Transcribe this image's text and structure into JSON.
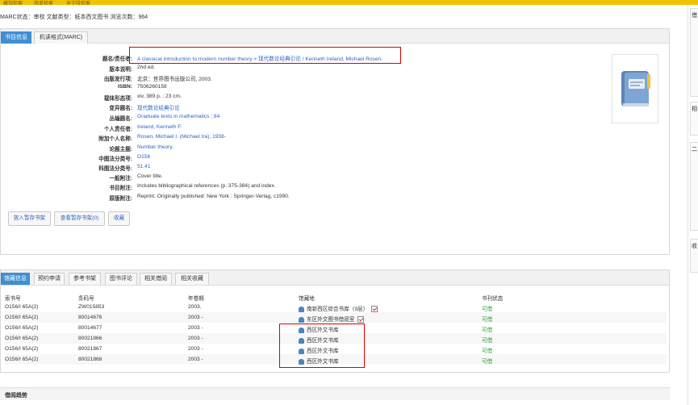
{
  "top_nav": [
    "藏馆检索",
    "简单检索",
    "多字段检索"
  ],
  "status_line": "MARC状态：审校 文献类型：纸本西文图书 浏览次数：964",
  "detail_tabs": [
    "书目信息",
    "机读格式(MARC)"
  ],
  "fields": [
    {
      "label": "题名/责任者:",
      "value": "A classical introduction to modern number theory = 现代数论经典引论 / Kenneth Ireland, Michael Rosen.",
      "link": true
    },
    {
      "label": "版本说明:",
      "value": "2nd ed.",
      "link": false
    },
    {
      "label": "出版发行项:",
      "value": "北京：世界图书出版公司, 2003.",
      "link": false
    },
    {
      "label": "ISBN:",
      "value": "7506260158",
      "link": false
    },
    {
      "label": "载体形态项:",
      "value": "xiv, 389 p. ; 23 cm.",
      "link": false
    },
    {
      "label": "变异题名:",
      "value": "现代数论经典引论",
      "link": true
    },
    {
      "label": "丛编题名:",
      "value": "Graduate texts in mathematics ; 84",
      "link": true
    },
    {
      "label": "个人责任者:",
      "value": "Ireland, Kenneth F.",
      "link": true
    },
    {
      "label": "附加个人名称:",
      "value": "Rosen, Michael I. (Michael Ira), 1938-",
      "link": true
    },
    {
      "label": "论题主题:",
      "value": "Number theory.",
      "link": true
    },
    {
      "label": "中图法分类号:",
      "value": "O156",
      "link": true
    },
    {
      "label": "科图法分类号:",
      "value": "51.41",
      "link": true
    },
    {
      "label": "一般附注:",
      "value": "Cover title.",
      "link": false
    },
    {
      "label": "书目附注:",
      "value": "Includes bibliographical references (p. 375-384) and index.",
      "link": false
    },
    {
      "label": "原版附注:",
      "value": "Reprint. Originally published: New York : Springer-Verlag, c1990.",
      "link": false
    }
  ],
  "buttons": {
    "add_shelf": "放入暂存书架",
    "view_shelf": "查看暂存书架(0)",
    "collect": "收藏"
  },
  "holding_tabs": [
    "馆藏信息",
    "预约申请",
    "参考书架",
    "图书评论",
    "相关借阅",
    "相关收藏"
  ],
  "holding_headers": [
    "索书号",
    "条码号",
    "年卷期",
    "馆藏地",
    "书刊状态"
  ],
  "holdings": [
    {
      "call": "O156/I 65A(2)",
      "barcode": "ZW015853",
      "year": "2003.",
      "location": "南新西区综合书库（9层）",
      "status": "可借",
      "mark": true
    },
    {
      "call": "O156/I 65A(2)",
      "barcode": "80014676",
      "year": "2003 -",
      "location": "东区外文图书借阅室",
      "status": "可借",
      "mark": true
    },
    {
      "call": "O156/I 65A(2)",
      "barcode": "80014677",
      "year": "2003 -",
      "location": "西区外文书库",
      "status": "可借",
      "mark": false
    },
    {
      "call": "O156/I 65A(2)",
      "barcode": "80021866",
      "year": "2003 -",
      "location": "西区外文书库",
      "status": "可借",
      "mark": false
    },
    {
      "call": "O156/I 65A(2)",
      "barcode": "80021867",
      "year": "2003 -",
      "location": "西区外文书库",
      "status": "可借",
      "mark": false
    },
    {
      "call": "O156/I 65A(2)",
      "barcode": "80021868",
      "year": "2003 -",
      "location": "西区外文书库",
      "status": "可借",
      "mark": false
    }
  ],
  "bottom_title": "借阅趋势",
  "right_panel": [
    "借",
    "相",
    "二",
    "收"
  ],
  "colors": {
    "accent": "#3f8fd3",
    "highlight": "#d60000",
    "available": "#2b9a2b",
    "topbar": "#f2c200"
  }
}
